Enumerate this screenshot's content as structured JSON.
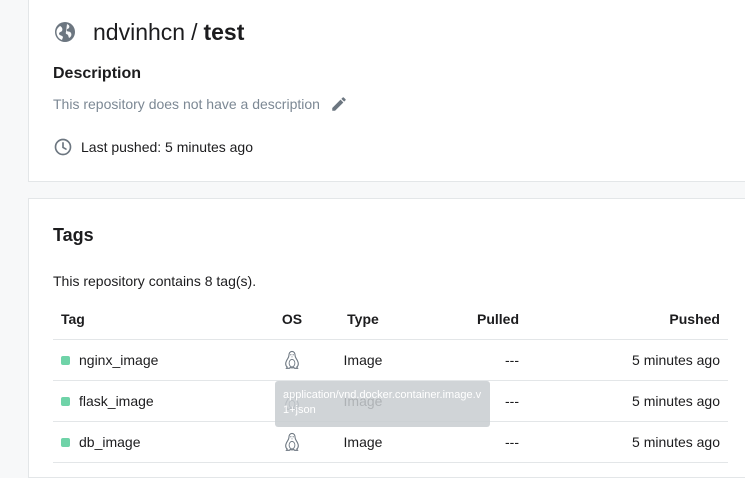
{
  "repository": {
    "namespace": "ndvinhcn",
    "separator": "/",
    "name": "test",
    "visibility_icon": "globe-icon"
  },
  "description": {
    "heading": "Description",
    "text": "This repository does not have a description",
    "edit_icon": "pencil-icon"
  },
  "last_pushed": {
    "icon": "clock-icon",
    "text": "Last pushed: 5 minutes ago"
  },
  "tags_section": {
    "heading": "Tags",
    "count_text": "This repository contains 8 tag(s).",
    "columns": {
      "tag": "Tag",
      "os": "OS",
      "type": "Type",
      "pulled": "Pulled",
      "pushed": "Pushed"
    },
    "rows": [
      {
        "tag": "nginx_image",
        "os_icon": "linux-icon",
        "type": "Image",
        "pulled": "---",
        "pushed": "5 minutes ago"
      },
      {
        "tag": "flask_image",
        "os_icon": "linux-icon",
        "type": "Image",
        "pulled": "---",
        "pushed": "5 minutes ago"
      },
      {
        "tag": "db_image",
        "os_icon": "linux-icon",
        "type": "Image",
        "pulled": "---",
        "pushed": "5 minutes ago"
      }
    ]
  },
  "tooltip": {
    "text": "application/vnd.docker.container.image.v1+json"
  },
  "colors": {
    "tag_dot": "#6fd3a8",
    "muted_text": "#7c8894",
    "icon_gray": "#6c7680"
  }
}
